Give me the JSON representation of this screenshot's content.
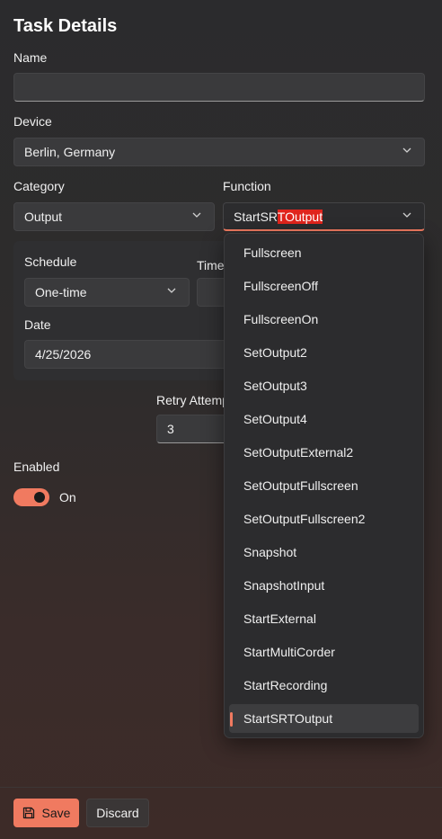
{
  "page_title": "Task Details",
  "name": {
    "label": "Name",
    "value": ""
  },
  "device": {
    "label": "Device",
    "value": "Berlin, Germany"
  },
  "category": {
    "label": "Category",
    "value": "Output"
  },
  "function": {
    "label": "Function",
    "value_plain": "StartSR",
    "value_highlight": "TOutput",
    "options": [
      "Fullscreen",
      "FullscreenOff",
      "FullscreenOn",
      "SetOutput2",
      "SetOutput3",
      "SetOutput4",
      "SetOutputExternal2",
      "SetOutputFullscreen",
      "SetOutputFullscreen2",
      "Snapshot",
      "SnapshotInput",
      "StartExternal",
      "StartMultiCorder",
      "StartRecording",
      "StartSRTOutput"
    ],
    "selected_option": "StartSRTOutput"
  },
  "schedule": {
    "label": "Schedule",
    "value": "One-time"
  },
  "time": {
    "label": "Time"
  },
  "date": {
    "label": "Date",
    "value": "4/25/2026"
  },
  "retry": {
    "label": "Retry Attemp",
    "value": "3"
  },
  "enabled": {
    "label": "Enabled",
    "state_label": "On",
    "on": true
  },
  "footer": {
    "save_label": "Save",
    "discard_label": "Discard"
  },
  "colors": {
    "accent": "#f07a60",
    "text_highlight": "#e0241c",
    "background": "#2b2b2d"
  },
  "icons": {
    "dropdown": "chevron-down-icon",
    "save": "save-icon"
  }
}
